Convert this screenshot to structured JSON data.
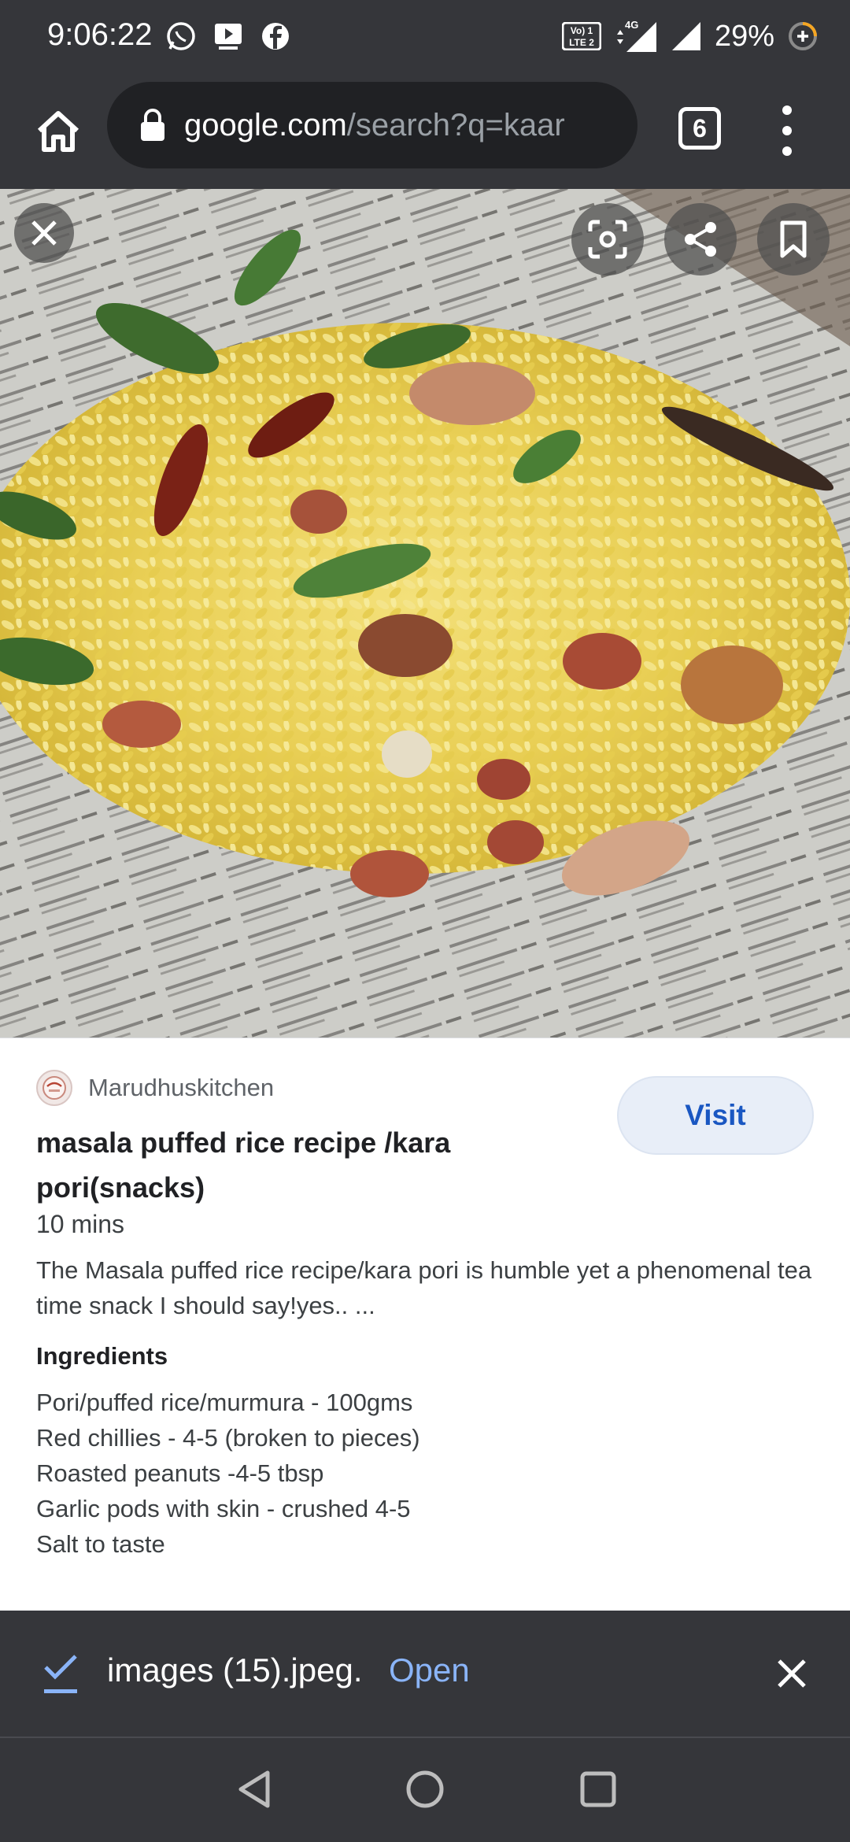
{
  "status_bar": {
    "time": "9:06:22",
    "battery_percent": "29%",
    "network_label": "4G",
    "volte_label": "Vo) 1\nLTE 2",
    "notification_icons": [
      "whatsapp-icon",
      "video-icon",
      "facebook-icon"
    ]
  },
  "browser": {
    "url_domain": "google.com",
    "url_path": "/search?q=kaar",
    "tab_count": "6"
  },
  "result": {
    "source_name": "Marudhuskitchen",
    "visit_label": "Visit",
    "title": "masala puffed rice recipe /kara pori(snacks)",
    "time": "10 mins",
    "description": "The Masala puffed rice recipe/kara pori is humble yet a phenomenal tea time snack I should say!yes.. ...",
    "ingredients_heading": "Ingredients",
    "ingredients": [
      "Pori/puffed rice/murmura - 100gms",
      "Red chillies - 4-5 (broken to pieces)",
      "Roasted peanuts -4-5 tbsp",
      "Garlic pods with skin - crushed 4-5",
      "Salt to taste"
    ]
  },
  "download_bar": {
    "filename": "images (15).jpeg.",
    "open_label": "Open"
  },
  "colors": {
    "chrome_dark": "#35363a",
    "url_bar": "#202124",
    "link_blue": "#8ab4f8",
    "visit_text": "#1a57c2",
    "visit_bg": "#e8eef8"
  }
}
